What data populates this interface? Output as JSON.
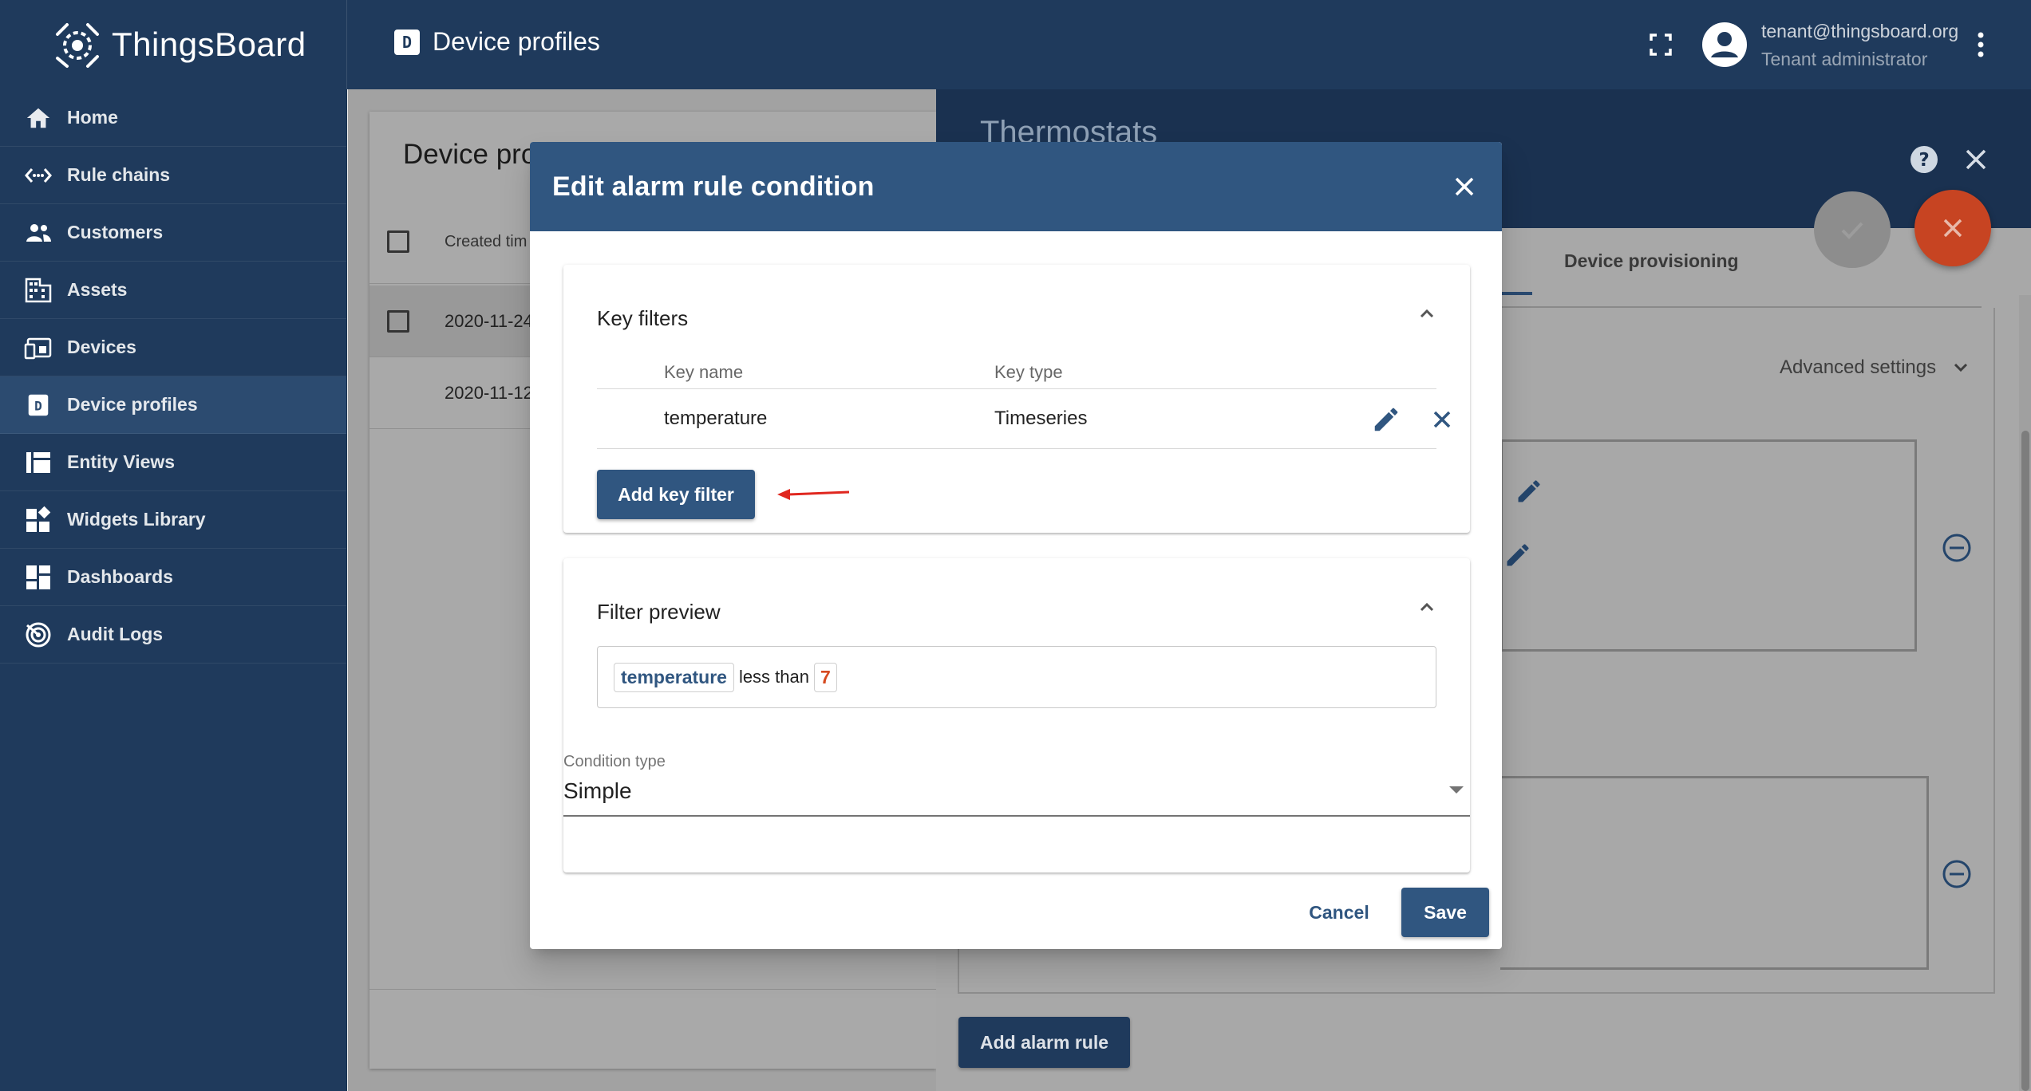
{
  "app": {
    "name": "ThingsBoard"
  },
  "header": {
    "page_title": "Device profiles",
    "page_icon_letter": "D",
    "user_email": "tenant@thingsboard.org",
    "user_role": "Tenant administrator"
  },
  "sidebar": {
    "items": [
      {
        "label": "Home",
        "icon": "home-icon"
      },
      {
        "label": "Rule chains",
        "icon": "rule-chains-icon"
      },
      {
        "label": "Customers",
        "icon": "customers-icon"
      },
      {
        "label": "Assets",
        "icon": "assets-icon"
      },
      {
        "label": "Devices",
        "icon": "devices-icon"
      },
      {
        "label": "Device profiles",
        "icon": "device-profiles-icon",
        "active": true
      },
      {
        "label": "Entity Views",
        "icon": "entity-views-icon"
      },
      {
        "label": "Widgets Library",
        "icon": "widgets-library-icon"
      },
      {
        "label": "Dashboards",
        "icon": "dashboards-icon"
      },
      {
        "label": "Audit Logs",
        "icon": "audit-logs-icon"
      }
    ]
  },
  "background": {
    "card_title": "Device pro",
    "column_created": "Created tim",
    "rows": [
      "2020-11-24",
      "2020-11-12"
    ],
    "panel_title": "Thermostats",
    "tab_provisioning": "Device provisioning",
    "advanced_settings": "Advanced settings",
    "add_alarm_rule": "Add alarm rule"
  },
  "dialog": {
    "title": "Edit alarm rule condition",
    "key_filters": {
      "title": "Key filters",
      "columns": {
        "key_name": "Key name",
        "key_type": "Key type"
      },
      "rows": [
        {
          "key_name": "temperature",
          "key_type": "Timeseries"
        }
      ],
      "add_button": "Add key filter"
    },
    "filter_preview": {
      "title": "Filter preview",
      "key": "temperature",
      "operation": "less than",
      "value": "7"
    },
    "condition_type": {
      "label": "Condition type",
      "value": "Simple"
    },
    "cancel_label": "Cancel",
    "save_label": "Save"
  },
  "colors": {
    "primary": "#305680",
    "sidebar": "#1f3a5c",
    "accent": "#d64a20",
    "arrow": "#e0271f"
  }
}
